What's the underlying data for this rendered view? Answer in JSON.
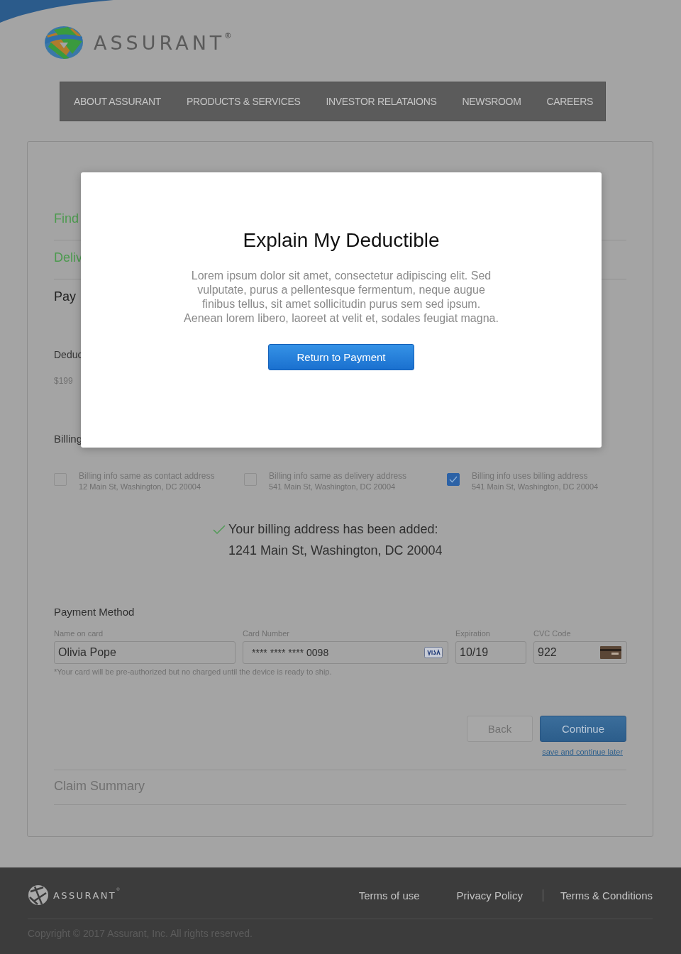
{
  "brand": {
    "name": "ASSURANT",
    "mark": "®"
  },
  "nav": [
    {
      "label": "ABOUT ASSURANT"
    },
    {
      "label": "PRODUCTS & SERVICES"
    },
    {
      "label": "INVESTOR RELATAIONS"
    },
    {
      "label": "NEWSROOM"
    },
    {
      "label": "CAREERS"
    }
  ],
  "steps": [
    {
      "label": "Find",
      "completed": true
    },
    {
      "label": "Deliv",
      "completed": true
    },
    {
      "label": "Pay",
      "completed": false
    }
  ],
  "deductible": {
    "label": "Deduc",
    "amount": "$199"
  },
  "billing": {
    "label": "Billing",
    "options": [
      {
        "title": "Billing info same as contact address",
        "address": "12 Main St, Washington, DC 20004",
        "checked": false
      },
      {
        "title": "Billing info same as delivery address",
        "address": "541 Main St, Washington, DC 20004",
        "checked": false
      },
      {
        "title": "Billing info uses billing address",
        "address": "541 Main St, Washington, DC 20004",
        "checked": true
      }
    ],
    "confirmation": {
      "message": "Your billing address has been added:",
      "address": "1241 Main St, Washington, DC 20004"
    }
  },
  "payment": {
    "title": "Payment Method",
    "fields": [
      {
        "label": "Name on card",
        "value": "Olivia Pope",
        "kind": "text"
      },
      {
        "label": "Card Number",
        "value": "**** **** **** 0098",
        "kind": "card"
      },
      {
        "label": "Expiration",
        "value": "10/19",
        "kind": "text"
      },
      {
        "label": "CVC Code",
        "value": "922",
        "kind": "cvc"
      }
    ],
    "note": "*Your card will be pre-authorized but no charged until the device is ready to ship."
  },
  "actions": {
    "back": "Back",
    "continue": "Continue",
    "save_link": "save and continue later"
  },
  "claim_summary": "Claim Summary",
  "modal": {
    "title": "Explain My Deductible",
    "body": "Lorem ipsum dolor sit amet, consectetur adipiscing elit. Sed vulputate, purus a pellentesque fermentum, neque augue finibus tellus, sit amet sollicitudin purus sem sed ipsum. Aenean lorem libero, laoreet at velit et, sodales feugiat magna.",
    "button": "Return to Payment"
  },
  "footer": {
    "brand": "ASSURANT",
    "mark": "®",
    "links": [
      "Terms of use",
      "Privacy Policy",
      "Terms & Conditions"
    ],
    "copyright": "Copyright © 2017 Assurant, Inc. All rights reserved."
  }
}
